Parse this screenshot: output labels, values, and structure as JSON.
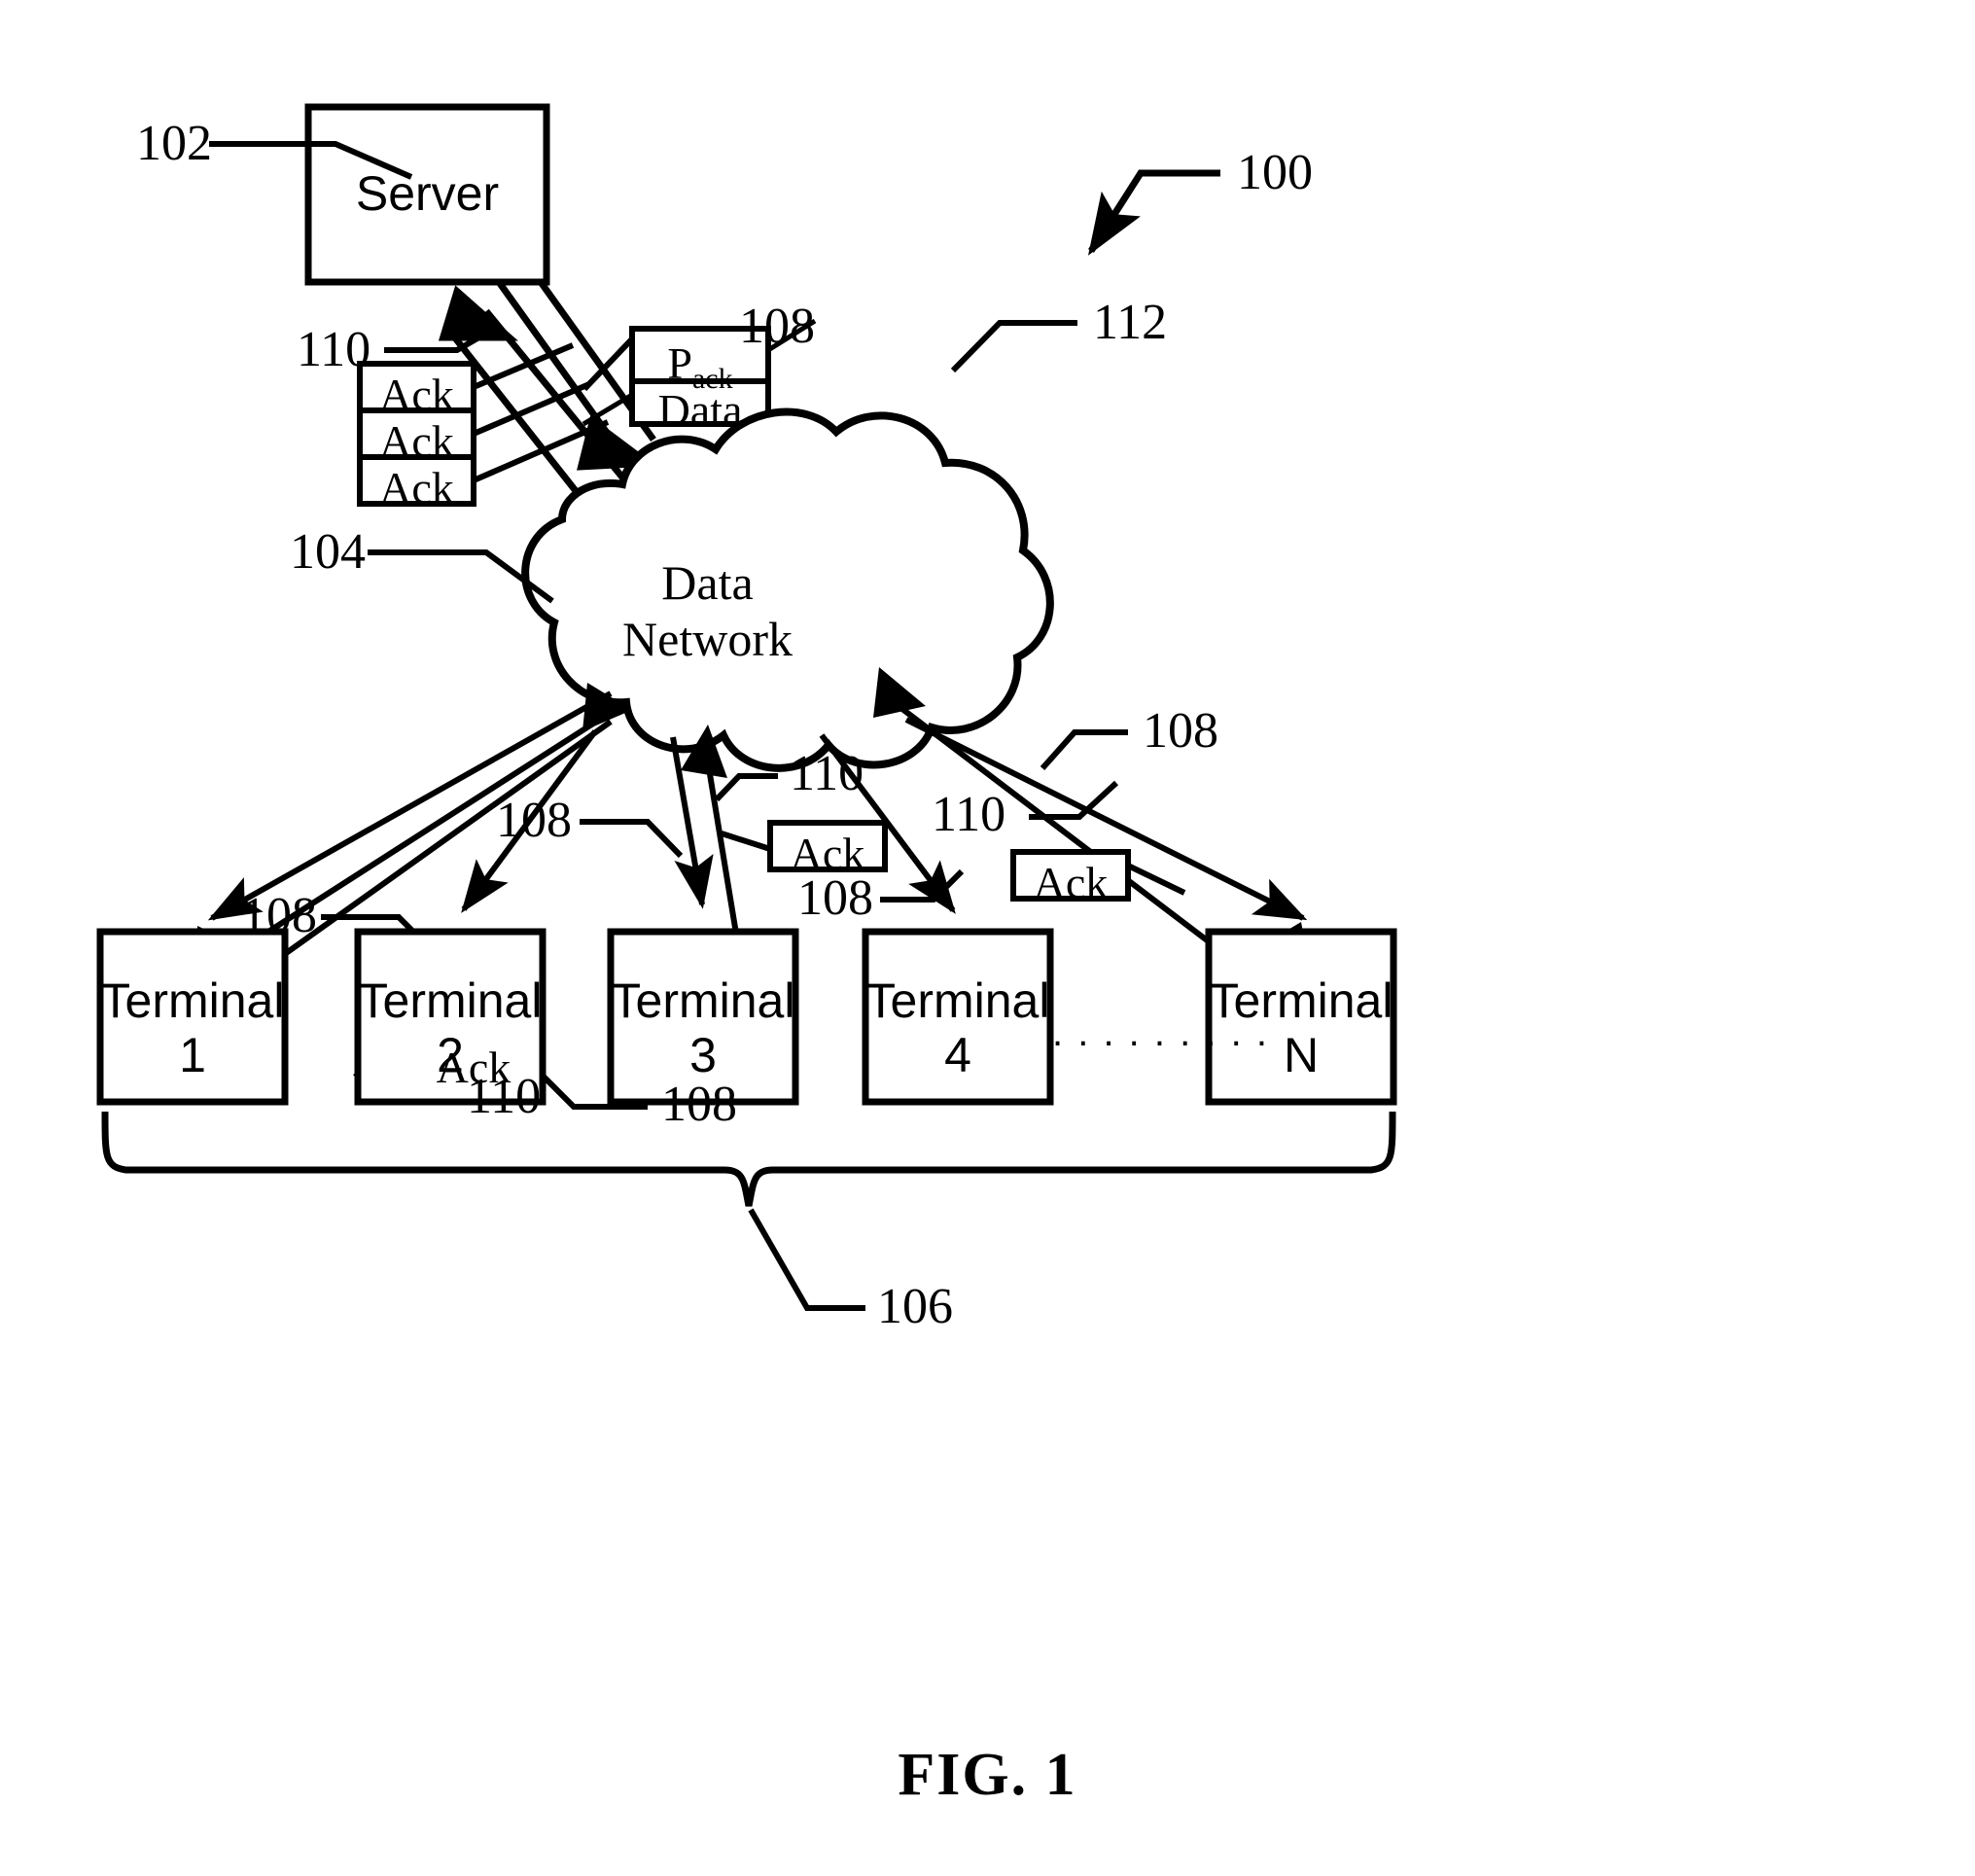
{
  "figure": {
    "caption": "FIG. 1",
    "system_ref": "100"
  },
  "nodes": {
    "server": {
      "label": "Server",
      "ref": "102"
    },
    "network": {
      "label_line1": "Data",
      "label_line2": "Network",
      "ref": "104"
    },
    "terminal_group": {
      "ref": "106",
      "ellipsis": ". . . . . . . . ."
    },
    "terminals": [
      {
        "name": "Terminal",
        "index": "1"
      },
      {
        "name": "Terminal",
        "index": "2"
      },
      {
        "name": "Terminal",
        "index": "3"
      },
      {
        "name": "Terminal",
        "index": "4"
      },
      {
        "name": "Terminal",
        "index": "N"
      }
    ]
  },
  "packet": {
    "ref": "112",
    "header_base": "P",
    "header_sub": "ack",
    "payload": "Data"
  },
  "ack_tokens": [
    {
      "label": "Ack"
    },
    {
      "label": "Ack"
    },
    {
      "label": "Ack"
    },
    {
      "label": "Ack"
    },
    {
      "label": "Ack"
    },
    {
      "label": "Ack"
    }
  ],
  "refs": {
    "data_flow": "108",
    "ack_flow": "110",
    "server": "102",
    "network": "104",
    "terminals": "106",
    "packet": "112",
    "system": "100"
  },
  "callouts": [
    {
      "id": "c-100",
      "text": "100"
    },
    {
      "id": "c-102",
      "text": "102"
    },
    {
      "id": "c-104",
      "text": "104"
    },
    {
      "id": "c-106",
      "text": "106"
    },
    {
      "id": "c-108-server",
      "text": "108"
    },
    {
      "id": "c-110-server",
      "text": "110"
    },
    {
      "id": "c-112",
      "text": "112"
    },
    {
      "id": "c-108-t1",
      "text": "108"
    },
    {
      "id": "c-110-t1",
      "text": "110"
    },
    {
      "id": "c-108-t2",
      "text": "108"
    },
    {
      "id": "c-108-t3",
      "text": "108"
    },
    {
      "id": "c-110-t3",
      "text": "110"
    },
    {
      "id": "c-108-t4",
      "text": "108"
    },
    {
      "id": "c-110-t5",
      "text": "110"
    },
    {
      "id": "c-108-t5",
      "text": "108"
    }
  ],
  "style": {
    "stroke": "#000000",
    "background": "#ffffff"
  }
}
